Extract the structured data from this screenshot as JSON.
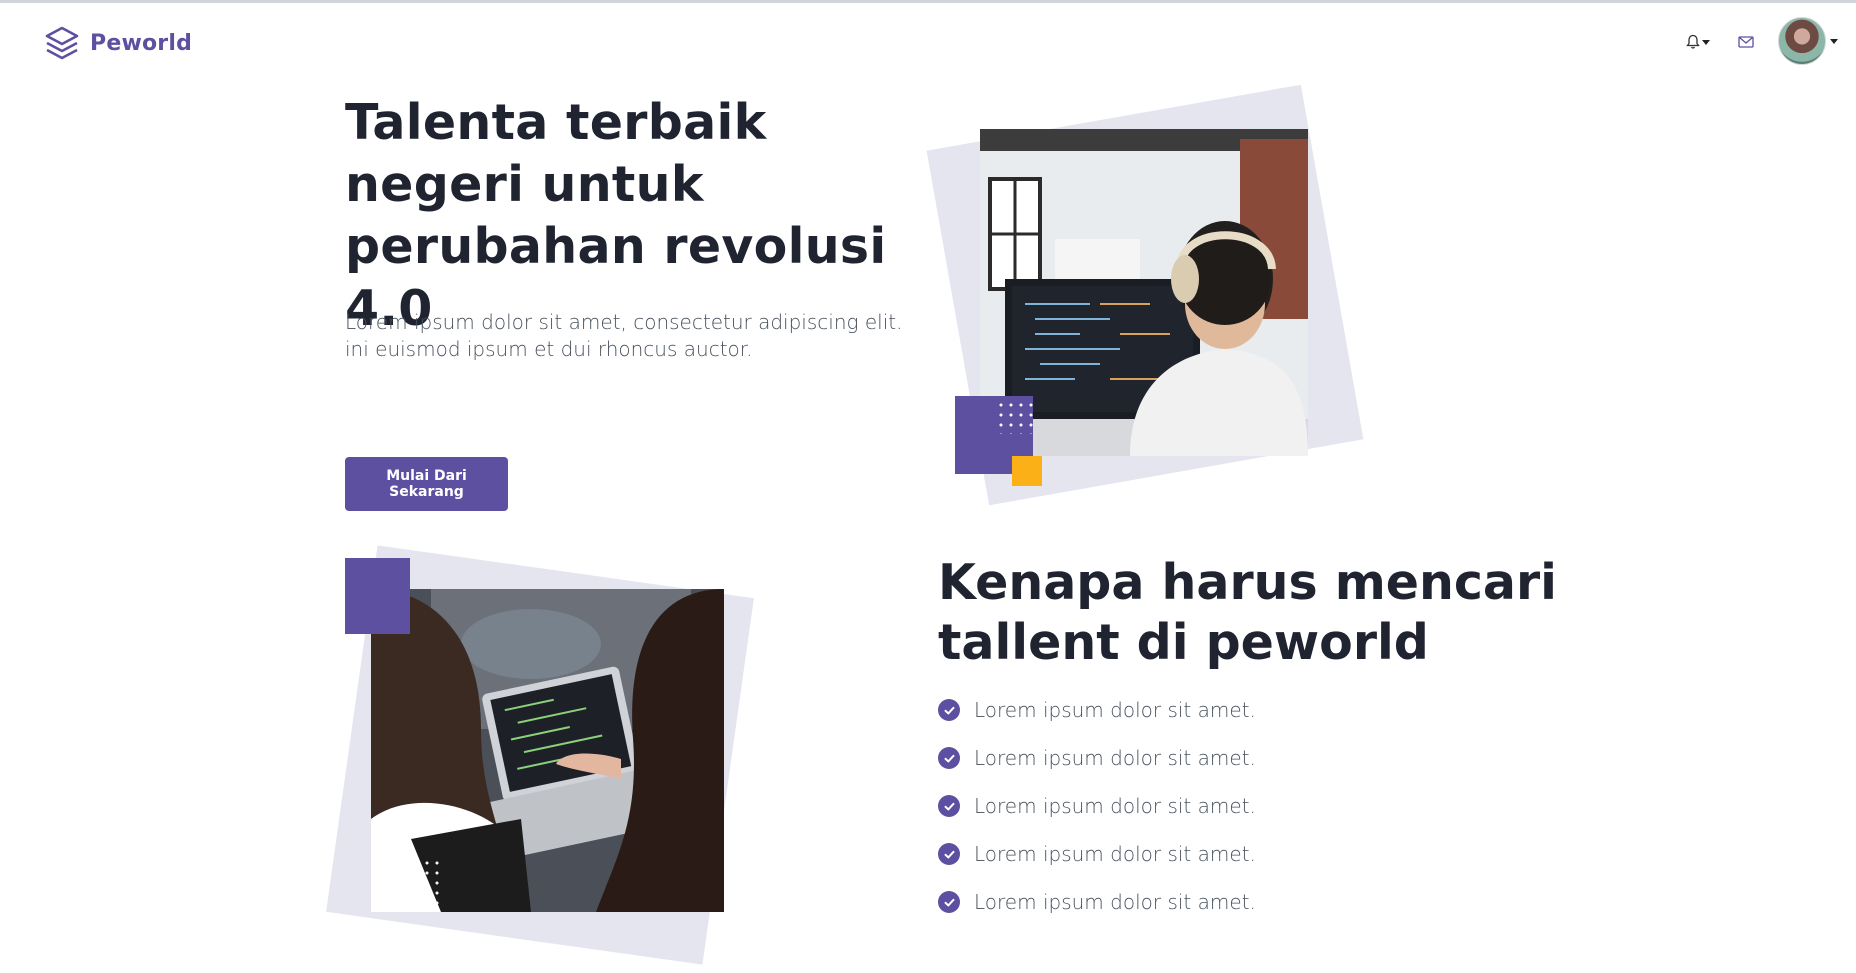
{
  "brand": {
    "name": "Peworld",
    "logo_icon": "layers-icon",
    "color": "#5e50a1"
  },
  "nav": {
    "notification_icon": "bell-icon",
    "message_icon": "mail-icon",
    "avatar_icon": "user-avatar"
  },
  "hero": {
    "title": "Talenta terbaik negeri untuk perubahan revolusi 4.0",
    "description": "Lorem ipsum dolor sit amet, consectetur adipiscing elit. ini euismod ipsum et dui rhoncus auctor.",
    "cta_label": "Mulai Dari Sekarang"
  },
  "why": {
    "title": "Kenapa harus mencari tallent di peworld",
    "items": [
      "Lorem ipsum dolor sit amet.",
      "Lorem ipsum dolor sit amet.",
      "Lorem ipsum dolor sit amet.",
      "Lorem ipsum dolor sit amet.",
      "Lorem ipsum dolor sit amet."
    ],
    "check_icon": "check-circle-icon"
  },
  "colors": {
    "accent": "#5e50a1",
    "highlight": "#fbb017",
    "backdrop": "#e4e5ee"
  }
}
